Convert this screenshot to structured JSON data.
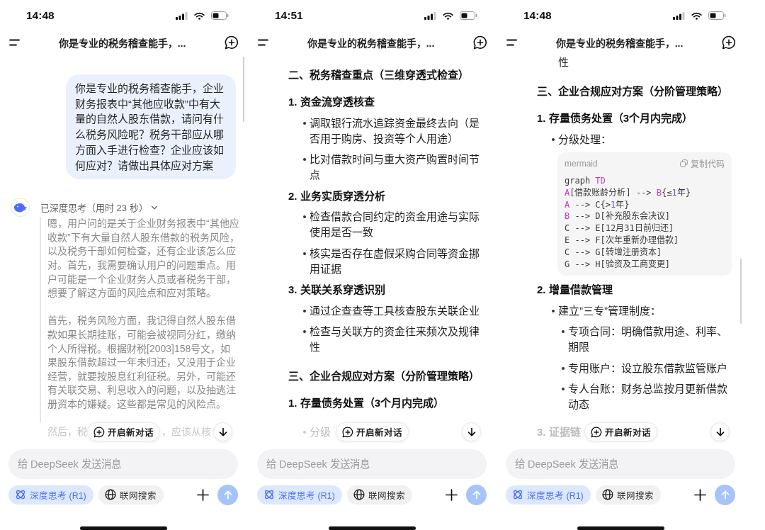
{
  "phones": [
    {
      "status_bar": {
        "time": "14:48"
      },
      "header": {
        "title": "你是专业的税务稽查能手，..."
      },
      "scroll_indicator": {
        "kind": "top"
      },
      "messages": [
        {
          "kind": "user",
          "text": "你是专业的税务稽查能手，企业财务报表中“其他应收款”中有大量的自然人股东借款，请问有什么税务风险呢？税务干部应从哪方面入手进行检查？企业应该如何应对？请做出具体应对方案"
        },
        {
          "kind": "reasoning",
          "summary": "已深度思考（用时 23 秒）",
          "expanded": true,
          "paragraphs": [
            "嗯，用户问的是关于企业财务报表中“其他应收款”下有大量自然人股东借款的税务风险，以及税务干部如何检查，还有企业该怎么应对。首先，我需要确认用户的问题重点。用户可能是一个企业财务人员或者税务干部，想要了解这方面的风险点和应对策略。",
            "首先，税务风险方面，我记得自然人股东借款如果长期挂账，可能会被视同分红，缴纳个人所得税。根据财税[2003]158号文，如果股东借款超过一年未归还，又没用于企业经营，就要按股息红利征税。另外，可能还有关联交易、利息收入的问题，以及抽逃注册资本的嫌疑。这些都是常见的风险点。"
          ]
        }
      ],
      "cut_off_line": {
        "kind": "paragraph",
        "before": "然后，税",
        "after": "，应该从核"
      },
      "new_chat_button": "开启新对话",
      "composer": {
        "placeholder": "给 DeepSeek 发送消息",
        "toggles": [
          {
            "kind": "reasoning",
            "label": "深度思考 (R1)",
            "selected": true
          },
          {
            "kind": "search",
            "label": "联网搜索",
            "selected": false
          }
        ],
        "send_button": {
          "disabled": true
        }
      }
    },
    {
      "status_bar": {
        "time": "14:51"
      },
      "header": {
        "title": "你是专业的税务稽查能手，..."
      },
      "messages": [
        {
          "kind": "answer",
          "blocks": [
            {
              "kind": "section",
              "text": "二、税务稽查重点（三维穿透式检查）"
            },
            {
              "kind": "item",
              "text": "1. 资金流穿透核查"
            },
            {
              "kind": "bullet",
              "text": "调取银行流水追踪资金最终去向（是否用于购房、投资等个人用途）"
            },
            {
              "kind": "bullet",
              "text": "比对借款时间与重大资产购置时间节点"
            },
            {
              "kind": "item",
              "text": "2. 业务实质穿透分析"
            },
            {
              "kind": "bullet",
              "text": "检查借款合同约定的资金用途与实际使用是否一致"
            },
            {
              "kind": "bullet",
              "text": "核实是否存在虚假采购合同等资金挪用证据"
            },
            {
              "kind": "item",
              "text": "3. 关联关系穿透识别"
            },
            {
              "kind": "bullet",
              "text": "通过企查查等工具核查股东关联企业"
            },
            {
              "kind": "bullet",
              "text": "检查与关联方的资金往来频次及规律性"
            },
            {
              "kind": "section",
              "text": "三、企业合规应对方案（分阶管理策略）"
            },
            {
              "kind": "item",
              "text": "1. 存量债务处置（3个月内完成）"
            }
          ]
        }
      ],
      "cut_off_line": {
        "kind": "bullet",
        "before": "分级"
      },
      "new_chat_button": "开启新对话",
      "composer": {
        "placeholder": "给 DeepSeek 发送消息",
        "toggles": [
          {
            "kind": "reasoning",
            "label": "深度思考 (R1)",
            "selected": true
          },
          {
            "kind": "search",
            "label": "联网搜索",
            "selected": false
          }
        ],
        "send_button": {
          "disabled": true
        }
      }
    },
    {
      "status_bar": {
        "time": "14:48"
      },
      "header": {
        "title": "你是专业的税务稽查能手，..."
      },
      "scroll_indicator": {
        "kind": "middle"
      },
      "messages": [
        {
          "kind": "answer",
          "blocks": [
            {
              "kind": "continuation",
              "text": "性"
            },
            {
              "kind": "section",
              "text": "三、企业合规应对方案（分阶管理策略）"
            },
            {
              "kind": "item",
              "text": "1. 存量债务处置（3个月内完成）"
            },
            {
              "kind": "bullet",
              "text": "分级处理："
            },
            {
              "kind": "code",
              "language": "mermaid",
              "copy_label": "复制代码",
              "lines": [
                {
                  "tokens": [
                    {
                      "text": "graph ",
                      "kind": "plain"
                    },
                    {
                      "text": "TD",
                      "kind": "keyword"
                    }
                  ]
                },
                {
                  "tokens": [
                    {
                      "text": "A",
                      "kind": "keyword"
                    },
                    {
                      "text": "[借款账龄分析] --> ",
                      "kind": "plain"
                    },
                    {
                      "text": "B",
                      "kind": "keyword"
                    },
                    {
                      "text": "{≤",
                      "kind": "plain"
                    },
                    {
                      "text": "1",
                      "kind": "number"
                    },
                    {
                      "text": "年}",
                      "kind": "plain"
                    }
                  ]
                },
                {
                  "tokens": [
                    {
                      "text": "A",
                      "kind": "keyword"
                    },
                    {
                      "text": " --> C{>",
                      "kind": "plain"
                    },
                    {
                      "text": "1",
                      "kind": "number"
                    },
                    {
                      "text": "年}",
                      "kind": "plain"
                    }
                  ]
                },
                {
                  "tokens": [
                    {
                      "text": "B",
                      "kind": "keyword"
                    },
                    {
                      "text": " --> D[补充股东会决议]",
                      "kind": "plain"
                    }
                  ]
                },
                {
                  "tokens": [
                    {
                      "text": "C --> E[12月31日前归还]",
                      "kind": "plain"
                    }
                  ]
                },
                {
                  "tokens": [
                    {
                      "text": "E --> F[次年重新办理借款]",
                      "kind": "plain"
                    }
                  ]
                },
                {
                  "tokens": [
                    {
                      "text": "C --> G[转增注册资本]",
                      "kind": "plain"
                    }
                  ]
                },
                {
                  "tokens": [
                    {
                      "text": "G --> H[验资及工商变更]",
                      "kind": "plain"
                    }
                  ]
                }
              ]
            },
            {
              "kind": "item",
              "text": "2. 增量借款管理"
            },
            {
              "kind": "bullet",
              "text": "建立”三专”管理制度：",
              "children": [
                {
                  "kind": "bullet",
                  "text": "专项合同：明确借款用途、利率、期限"
                },
                {
                  "kind": "bullet",
                  "text": "专用账户：设立股东借款监管账户"
                },
                {
                  "kind": "bullet",
                  "text": "专人台账：财务总监按月更新借款动态"
                }
              ]
            }
          ]
        }
      ],
      "cut_off_line": {
        "kind": "item",
        "before": "3. 证据链"
      },
      "new_chat_button": "开启新对话",
      "composer": {
        "placeholder": "给 DeepSeek 发送消息",
        "toggles": [
          {
            "kind": "reasoning",
            "label": "深度思考 (R1)",
            "selected": true
          },
          {
            "kind": "search",
            "label": "联网搜索",
            "selected": false
          }
        ],
        "send_button": {
          "disabled": true
        }
      }
    }
  ]
}
